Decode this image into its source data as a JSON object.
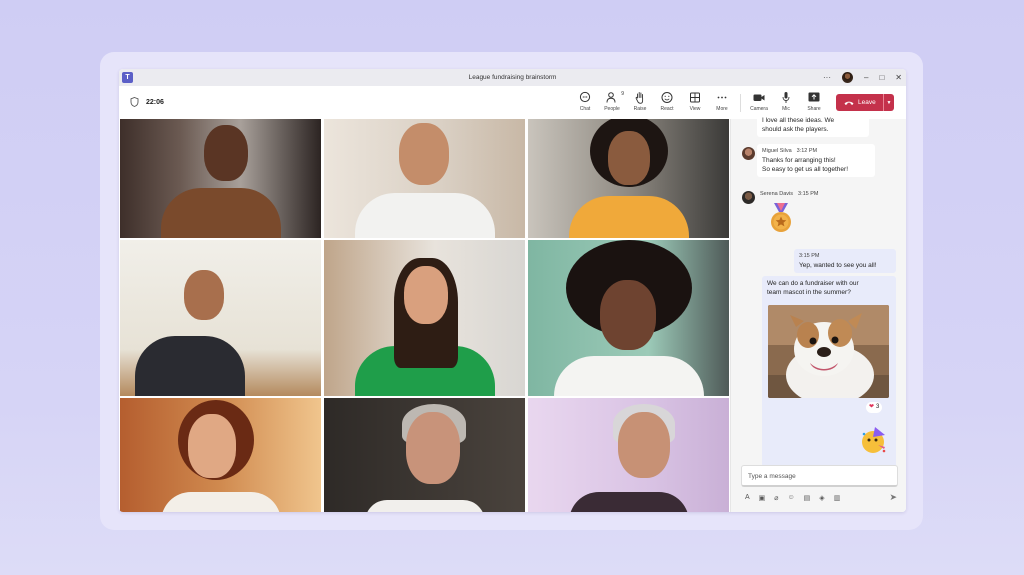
{
  "window": {
    "title": "League fundraising brainstorm",
    "more": "···",
    "minimize": "–",
    "maximize": "□",
    "close": "✕"
  },
  "meeting": {
    "time": "22:06"
  },
  "toolbar": {
    "chat": "Chat",
    "people": "People",
    "people_count": "9",
    "raise": "Raise",
    "react": "React",
    "view": "View",
    "more": "More",
    "camera": "Camera",
    "mic": "Mic",
    "share": "Share",
    "leave": "Leave"
  },
  "chat": {
    "messages": [
      {
        "type": "incoming",
        "text_lines": [
          "I love all these ideas. We",
          "should ask the players."
        ]
      },
      {
        "type": "incoming",
        "sender": "Miguel Silva",
        "time": "3:12 PM",
        "text_lines": [
          "Thanks for arranging this!",
          "So easy to get us all together!"
        ]
      },
      {
        "type": "incoming",
        "sender": "Serena Davis",
        "time": "3:15 PM",
        "sticker": "medal"
      },
      {
        "type": "outgoing",
        "time": "3:15 PM",
        "text": "Yep, wanted to see you all!"
      },
      {
        "type": "outgoing",
        "text_lines": [
          "We can do a fundraiser with our",
          "team mascot in the summer?"
        ],
        "image": "bulldog",
        "reaction": "❤",
        "reaction_count": "3"
      },
      {
        "type": "outgoing",
        "sticker": "party-face"
      }
    ],
    "composer_placeholder": "Type a message"
  },
  "colors": {
    "accent": "#5b5fc7",
    "leave": "#c4314b",
    "outgoing_bubble": "#e8ebfa"
  }
}
